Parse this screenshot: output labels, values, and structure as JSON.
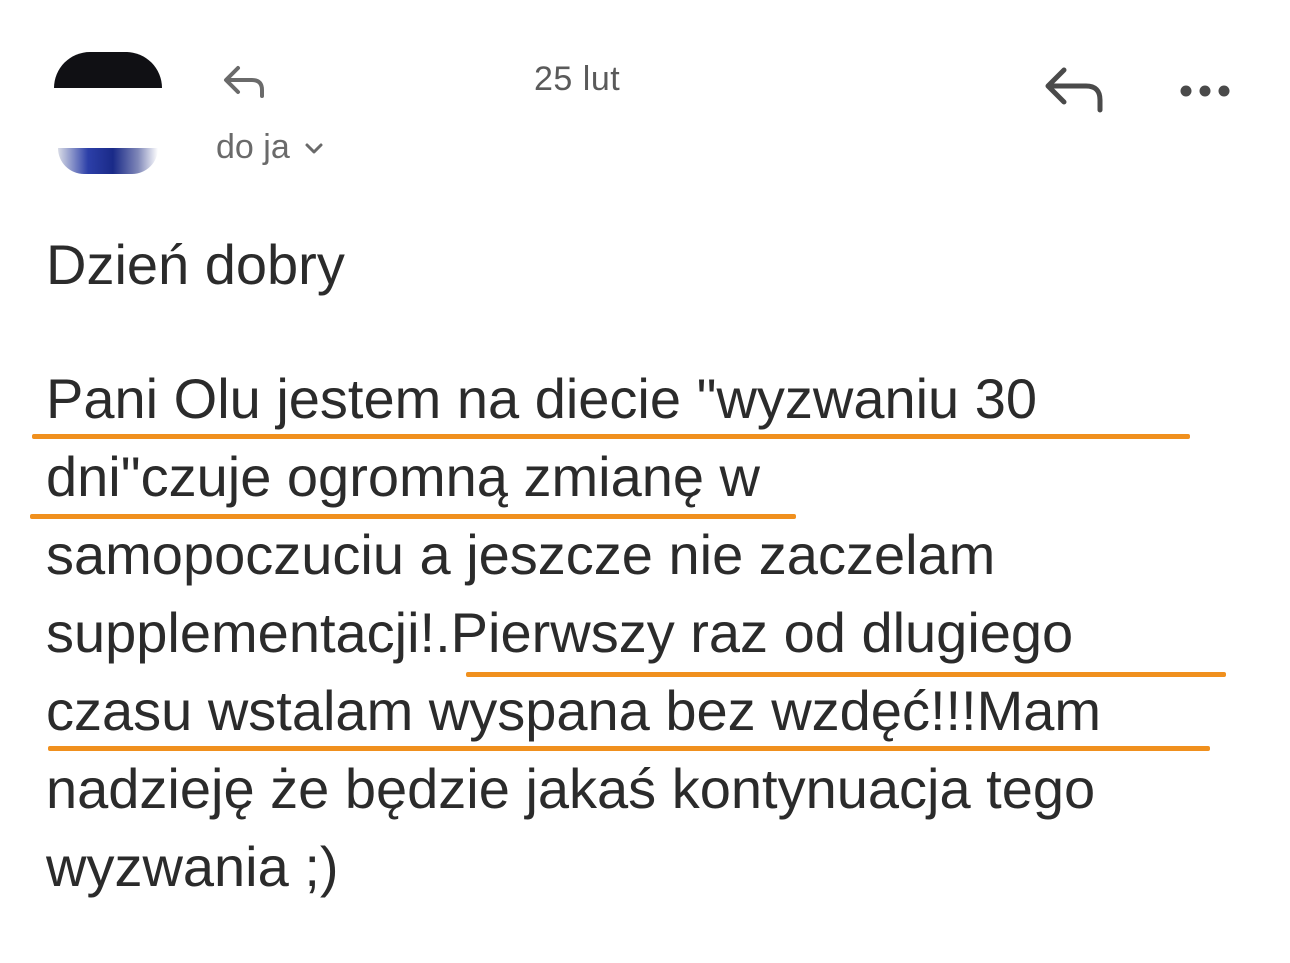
{
  "header": {
    "date": "25 lut",
    "recipient_label": "do ja",
    "icons": {
      "reply_small": "reply-icon",
      "reply": "reply-icon",
      "more": "more-horizontal-icon",
      "chevron": "chevron-down-icon"
    }
  },
  "email": {
    "greeting": "Dzień dobry",
    "body_lines": [
      "Pani Olu jestem na diecie \"wyzwaniu 30",
      "dni\"czuje ogromną zmianę w",
      "samopoczuciu a jeszcze nie zaczelam",
      "supplementacji!.Pierwszy raz od dlugiego",
      "czasu wstalam wyspana bez wzdęć!!!Mam",
      "nadzieję że będzie jakaś kontynuacja tego",
      "wyzwania ;)"
    ]
  },
  "colors": {
    "highlight_underline": "#f0901e",
    "text": "#2b2b2b",
    "muted": "#6a6a6a"
  }
}
